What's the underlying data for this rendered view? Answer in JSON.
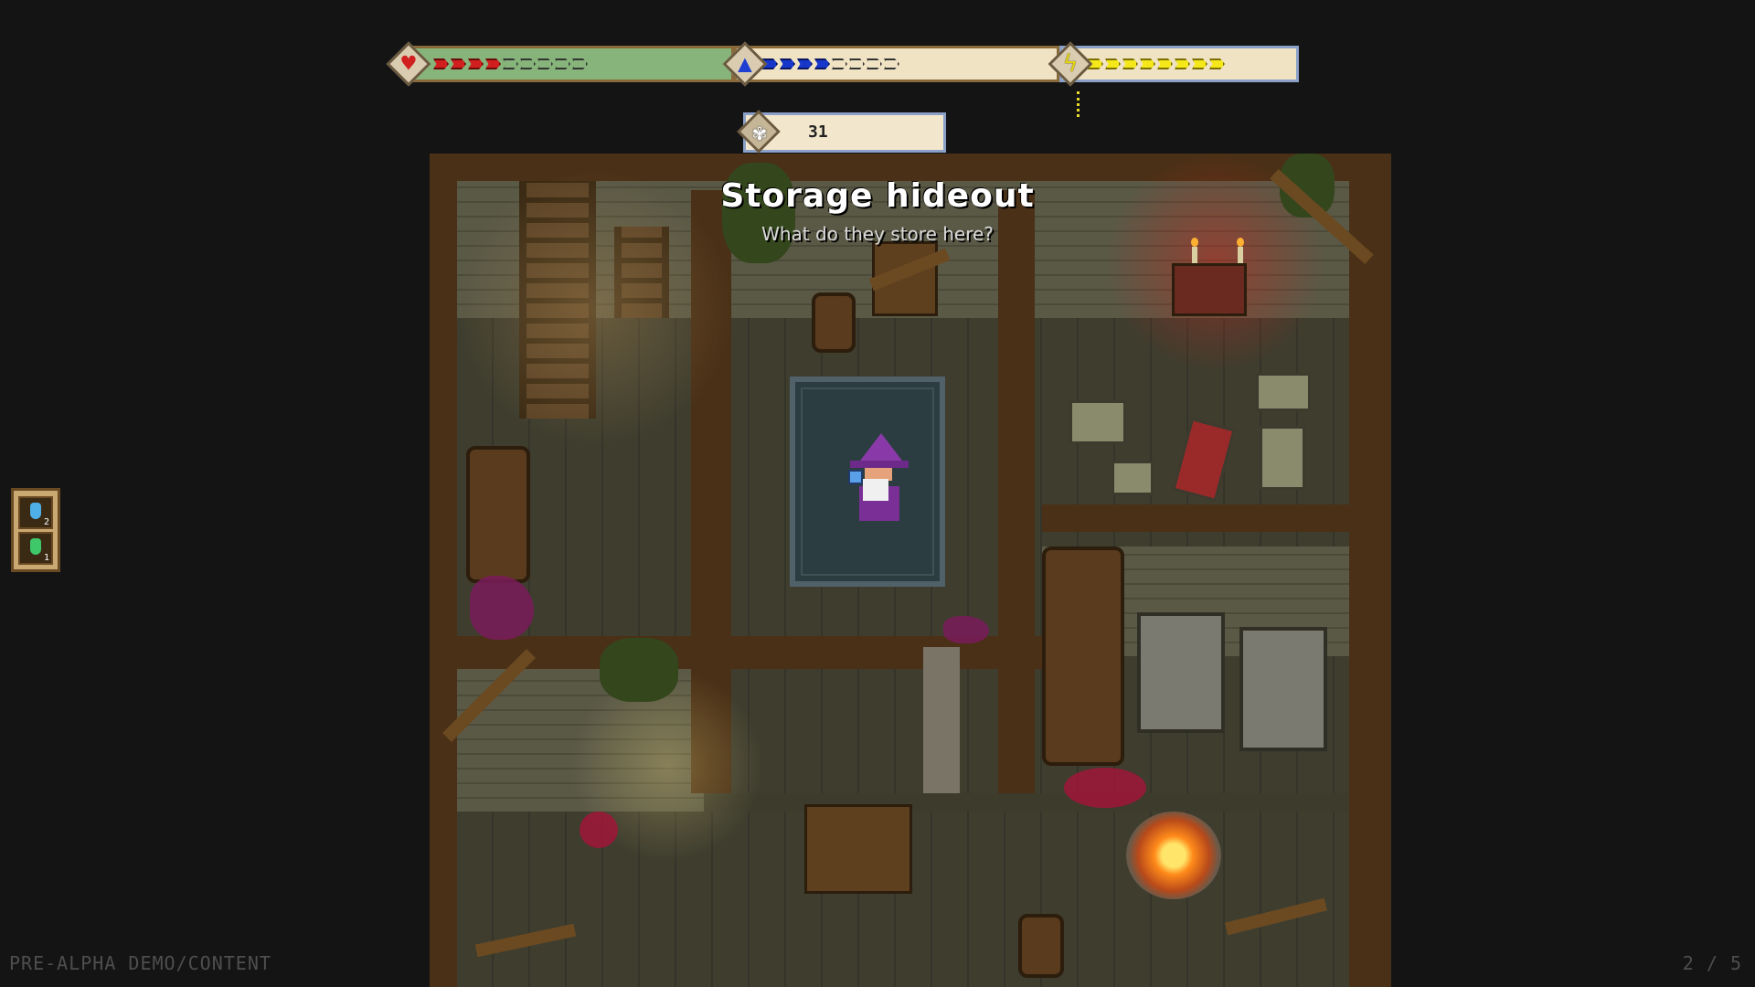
{
  "hud": {
    "health": {
      "icon": "heart-icon",
      "glyph": "♥",
      "filled": 4,
      "total": 9,
      "color": "#d11f1f"
    },
    "mana": {
      "icon": "wizard-hat-icon",
      "glyph": "▲",
      "filled": 4,
      "total": 8,
      "color": "#1637c9"
    },
    "stamina": {
      "icon": "lightning-icon",
      "glyph": "ϟ",
      "filled": 8,
      "total": 8,
      "color": "#f4e81a"
    }
  },
  "currency": {
    "icon": "soul-gem-icon",
    "glyph": "✾",
    "count": "31"
  },
  "location": {
    "title": "Storage hideout",
    "subtitle": "What do they store here?"
  },
  "inventory": {
    "slots": [
      {
        "icon": "blue-potion-icon",
        "color": "#4fb0e8",
        "count": "2"
      },
      {
        "icon": "green-potion-icon",
        "color": "#3fc86a",
        "count": "1"
      }
    ]
  },
  "footer": {
    "build_label": "PRE-ALPHA DEMO/CONTENT",
    "page_indicator": "2 / 5"
  }
}
